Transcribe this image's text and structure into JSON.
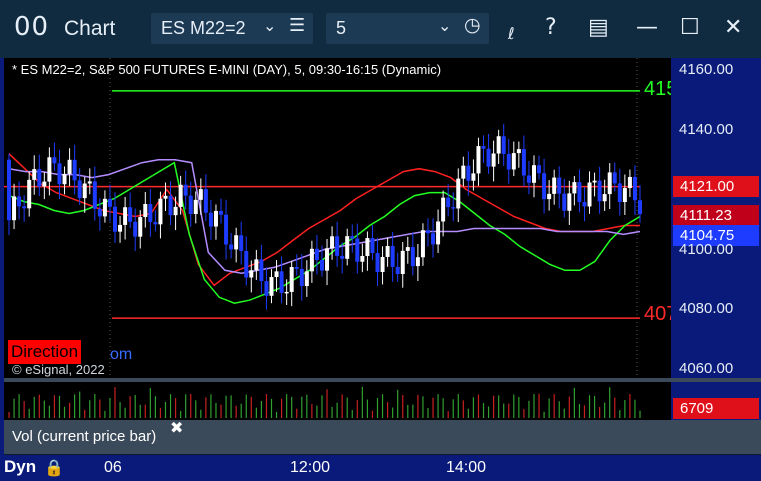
{
  "window": {
    "icon": "00",
    "title": "Chart",
    "symbol": "ES M22=2",
    "interval": "5",
    "icons": [
      "link-icon",
      "help-icon",
      "template-icon",
      "minimize-icon",
      "maximize-icon",
      "close-icon"
    ]
  },
  "chart": {
    "info_line": "* ES M22=2, S&P 500 FUTURES E-MINI (DAY), 5, 09:30-16:15 (Dynamic)",
    "copyright": "© eSignal, 2022",
    "direction_label": "Direction",
    "direction_suffix": "om",
    "level_green_label": "415",
    "level_red_label": "407"
  },
  "price_axis": {
    "labels": [
      "4160.00",
      "4140.00",
      "4120.00",
      "4100.00",
      "4080.00",
      "4060.00"
    ],
    "badge_red": "4121.00",
    "badge_darkred": "4111.23",
    "badge_current": "4104.75"
  },
  "volume": {
    "label": "Vol (current price bar)",
    "close": "✖",
    "badge": "6709"
  },
  "time_axis": {
    "mode": "Dyn",
    "labels": [
      "06",
      "12:00",
      "14:00"
    ]
  },
  "colors": {
    "up_candle": "#ffffff",
    "down_candle": "#1e3cff",
    "level_green": "#22ff22",
    "level_red": "#ff2a2a",
    "ma_red": "#ff2020",
    "ma_green": "#22ff22",
    "ma_purple": "#b48cff"
  },
  "chart_data": {
    "type": "line",
    "title": "* ES M22=2, S&P 500 FUTURES E-MINI (DAY), 5, 09:30-16:15 (Dynamic)",
    "xlabel": "",
    "ylabel": "",
    "x_ticks": [
      "06",
      "12:00",
      "14:00"
    ],
    "ylim": [
      4057,
      4164
    ],
    "levels": [
      4153,
      4121,
      4077
    ],
    "series": [
      {
        "values": [
          4132,
          4127,
          4122,
          4119,
          4117,
          4115,
          4113,
          4112,
          4111,
          4112,
          4120,
          4113,
          4095,
          4088,
          4092,
          4094,
          4096,
          4099,
          4103,
          4107,
          4110,
          4113,
          4117,
          4120,
          4123,
          4126,
          4127,
          4126,
          4124,
          4120,
          4117,
          4114,
          4111,
          4109,
          4107,
          4106,
          4106,
          4106,
          4107,
          4108,
          4108
        ]
      },
      {
        "values": [
          4118,
          4116,
          4115,
          4113,
          4112,
          4113,
          4115,
          4117,
          4120,
          4123,
          4126,
          4129,
          4105,
          4090,
          4084,
          4082,
          4083,
          4085,
          4087,
          4090,
          4093,
          4097,
          4101,
          4104,
          4108,
          4111,
          4115,
          4118,
          4119,
          4119,
          4116,
          4112,
          4108,
          4105,
          4101,
          4098,
          4095,
          4093,
          4093,
          4096,
          4103,
          4108,
          4111
        ]
      },
      {
        "values": [
          4127,
          4126,
          4126,
          4125,
          4125,
          4124,
          4125,
          4127,
          4129,
          4130,
          4130,
          4129,
          4099,
          4093,
          4092,
          4093,
          4094,
          4096,
          4098,
          4100,
          4101,
          4102,
          4103,
          4104,
          4105,
          4106,
          4106,
          4106,
          4107,
          4107,
          4107,
          4107,
          4107,
          4106,
          4106,
          4106,
          4106,
          4105,
          4106
        ]
      }
    ]
  }
}
